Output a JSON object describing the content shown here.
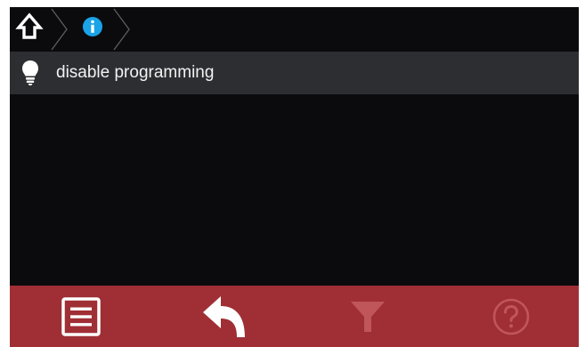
{
  "breadcrumb": {
    "items": [
      {
        "icon": "home-icon"
      },
      {
        "icon": "info-icon"
      }
    ]
  },
  "list": {
    "items": [
      {
        "icon": "lightbulb-icon",
        "label": "disable programming"
      }
    ]
  },
  "toolbar": {
    "buttons": [
      {
        "icon": "list-icon",
        "enabled": true
      },
      {
        "icon": "back-arrow-icon",
        "enabled": true
      },
      {
        "icon": "filter-icon",
        "enabled": false
      },
      {
        "icon": "help-icon",
        "enabled": false
      }
    ]
  },
  "colors": {
    "background": "#0b0b0d",
    "row_background": "#2c2e32",
    "toolbar_background": "#9f2f35",
    "info_accent": "#1aa3e8",
    "disabled_icon": "#c0555a"
  }
}
